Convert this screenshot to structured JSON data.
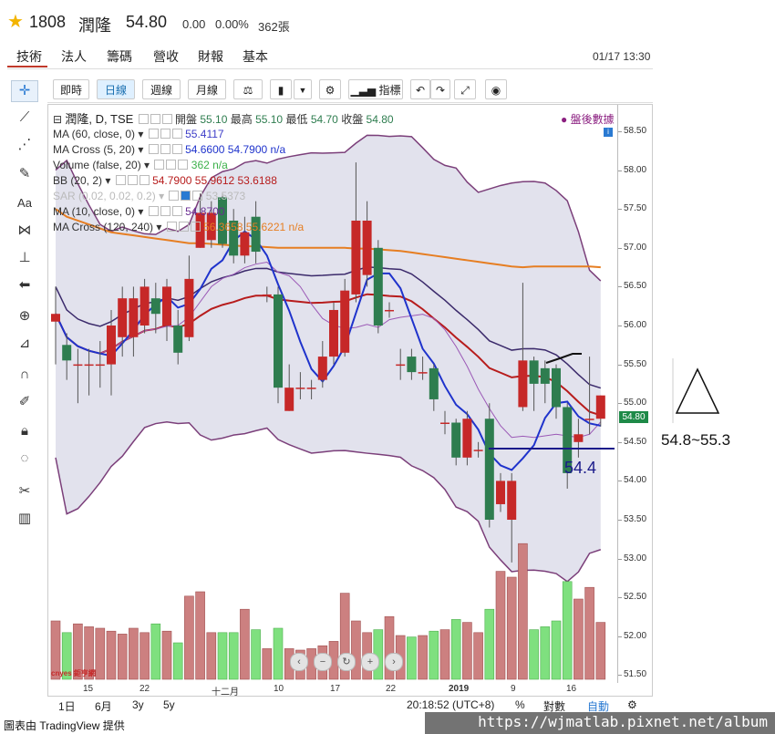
{
  "stock": {
    "code": "1808",
    "name": "潤隆",
    "price": "54.80",
    "change": "0.00",
    "change_pct": "0.00%",
    "volume": "362張"
  },
  "tabs": [
    "技術",
    "法人",
    "籌碼",
    "營收",
    "財報",
    "基本"
  ],
  "timestamp": "01/17 13:30",
  "toolbar": {
    "periods": [
      "即時",
      "日線",
      "週線",
      "月線"
    ],
    "indicators_label": "指標"
  },
  "legend": {
    "main": {
      "name": "潤隆, D, TSE",
      "open_label": "開盤",
      "open": "55.10",
      "high_label": "最高",
      "high": "55.10",
      "low_label": "最低",
      "low": "54.70",
      "close_label": "收盤",
      "close": "54.80"
    },
    "rows": [
      {
        "label": "MA (60, close, 0)",
        "values": "55.4117"
      },
      {
        "label": "MA Cross (5, 20)",
        "values": "54.6600 54.7900 n/a"
      },
      {
        "label": "Volume (false, 20)",
        "values": "362 n/a"
      },
      {
        "label": "BB (20, 2)",
        "values": "54.7900 55.9612 53.6188"
      },
      {
        "label": "SAR (0.02, 0.02, 0.2)",
        "values": "53.5373"
      },
      {
        "label": "MA (10, close, 0)",
        "values": "54.8700"
      },
      {
        "label": "MA Cross (120, 240)",
        "values": "56.3658 55.6221 n/a"
      }
    ],
    "after_hours": "盤後數據"
  },
  "y_ticks": [
    "58.50",
    "58.00",
    "57.50",
    "57.00",
    "56.50",
    "56.00",
    "55.50",
    "55.00",
    "54.50",
    "54.00",
    "53.50",
    "53.00",
    "52.50",
    "52.00",
    "51.50"
  ],
  "price_tag": "54.80",
  "x_ticks": [
    "15",
    "22",
    "十二月",
    "10",
    "17",
    "22",
    "2019",
    "9",
    "16"
  ],
  "bottom": {
    "ranges": [
      "1日",
      "6月",
      "3y",
      "5y"
    ],
    "clock": "20:18:52 (UTC+8)",
    "pct": "%",
    "log": "對數",
    "auto": "自動"
  },
  "annotations": {
    "target": "54.8~55.3",
    "support": "54.4"
  },
  "logo_text": "cnyes 鉅亨網",
  "footer": {
    "credit": "圖表由 TradingView 提供",
    "url": "https://wjmatlab.pixnet.net/album"
  },
  "colors": {
    "up": "#c62828",
    "down": "#2e7d4f",
    "ma60": "#e67e22",
    "ma_fast": "#1f33cc",
    "bb_mid": "#b71c1c",
    "bb_band": "#7b3f7a",
    "sar": "#9b59b6"
  },
  "chart_data": {
    "type": "candlestick",
    "ylim": [
      51.35,
      58.75
    ],
    "candles": [
      {
        "o": 56.05,
        "c": 56.15,
        "h": 56.5,
        "l": 55.5
      },
      {
        "o": 55.75,
        "c": 55.55,
        "h": 55.9,
        "l": 55.3
      },
      {
        "o": 55.5,
        "c": 55.5,
        "h": 55.7,
        "l": 55.0
      },
      {
        "o": 55.5,
        "c": 55.5,
        "h": 55.7,
        "l": 55.1
      },
      {
        "o": 55.5,
        "c": 55.5,
        "h": 55.8,
        "l": 55.2
      },
      {
        "o": 55.5,
        "c": 56.0,
        "h": 56.2,
        "l": 55.1
      },
      {
        "o": 55.85,
        "c": 56.35,
        "h": 56.5,
        "l": 55.6
      },
      {
        "o": 55.85,
        "c": 56.35,
        "h": 56.5,
        "l": 55.6
      },
      {
        "o": 56.0,
        "c": 56.5,
        "h": 56.6,
        "l": 55.9
      },
      {
        "o": 56.35,
        "c": 56.15,
        "h": 56.55,
        "l": 55.9
      },
      {
        "o": 56.0,
        "c": 56.5,
        "h": 56.6,
        "l": 55.8
      },
      {
        "o": 56.0,
        "c": 55.65,
        "h": 56.2,
        "l": 55.5
      },
      {
        "o": 55.85,
        "c": 56.6,
        "h": 56.9,
        "l": 55.8
      },
      {
        "o": 57.0,
        "c": 57.45,
        "h": 57.7,
        "l": 57.0
      },
      {
        "o": 57.1,
        "c": 57.45,
        "h": 57.6,
        "l": 57.0
      },
      {
        "o": 57.65,
        "c": 57.05,
        "h": 57.7,
        "l": 57.0
      },
      {
        "o": 57.35,
        "c": 56.9,
        "h": 57.5,
        "l": 56.8
      },
      {
        "o": 56.9,
        "c": 57.2,
        "h": 57.4,
        "l": 56.8
      },
      {
        "o": 57.4,
        "c": 56.95,
        "h": 57.6,
        "l": 56.8
      },
      {
        "o": 56.4,
        "c": 56.4,
        "h": 56.5,
        "l": 56.3
      },
      {
        "o": 56.4,
        "c": 55.2,
        "h": 56.5,
        "l": 55.0
      },
      {
        "o": 54.9,
        "c": 55.2,
        "h": 55.5,
        "l": 54.9
      },
      {
        "o": 55.2,
        "c": 55.2,
        "h": 55.4,
        "l": 55.05
      },
      {
        "o": 55.2,
        "c": 55.2,
        "h": 55.3,
        "l": 55.05
      },
      {
        "o": 55.3,
        "c": 55.6,
        "h": 55.8,
        "l": 55.2
      },
      {
        "o": 55.6,
        "c": 56.2,
        "h": 56.3,
        "l": 55.5
      },
      {
        "o": 55.65,
        "c": 56.45,
        "h": 56.6,
        "l": 55.6
      },
      {
        "o": 56.4,
        "c": 57.35,
        "h": 58.1,
        "l": 56.3
      },
      {
        "o": 56.65,
        "c": 57.35,
        "h": 57.6,
        "l": 56.5
      },
      {
        "o": 57.0,
        "c": 56.0,
        "h": 57.1,
        "l": 55.9
      },
      {
        "o": 56.2,
        "c": 56.2,
        "h": 56.3,
        "l": 56.1
      },
      {
        "o": 55.5,
        "c": 55.5,
        "h": 55.7,
        "l": 55.3
      },
      {
        "o": 55.6,
        "c": 55.4,
        "h": 55.7,
        "l": 55.3
      },
      {
        "o": 55.4,
        "c": 55.4,
        "h": 55.6,
        "l": 55.3
      },
      {
        "o": 55.45,
        "c": 55.05,
        "h": 55.5,
        "l": 54.9
      },
      {
        "o": 54.75,
        "c": 54.75,
        "h": 54.9,
        "l": 54.6
      },
      {
        "o": 54.75,
        "c": 54.3,
        "h": 54.8,
        "l": 54.2
      },
      {
        "o": 54.3,
        "c": 54.8,
        "h": 54.9,
        "l": 54.2
      },
      {
        "o": 54.4,
        "c": 54.4,
        "h": 54.5,
        "l": 54.3
      },
      {
        "o": 54.8,
        "c": 53.5,
        "h": 55.0,
        "l": 53.4
      },
      {
        "o": 53.7,
        "c": 54.0,
        "h": 54.1,
        "l": 53.6
      },
      {
        "o": 53.5,
        "c": 54.0,
        "h": 54.1,
        "l": 52.95
      },
      {
        "o": 54.95,
        "c": 55.55,
        "h": 56.55,
        "l": 54.9
      },
      {
        "o": 55.55,
        "c": 55.25,
        "h": 55.6,
        "l": 54.9
      },
      {
        "o": 55.45,
        "c": 55.25,
        "h": 55.55,
        "l": 55.0
      },
      {
        "o": 55.45,
        "c": 54.95,
        "h": 55.5,
        "l": 54.8
      },
      {
        "o": 54.95,
        "c": 54.1,
        "h": 55.0,
        "l": 53.9
      },
      {
        "o": 54.5,
        "c": 54.6,
        "h": 54.8,
        "l": 54.3
      },
      {
        "o": 54.8,
        "c": 54.8,
        "h": 55.6,
        "l": 54.6
      },
      {
        "o": 54.8,
        "c": 55.1,
        "h": 55.1,
        "l": 54.7
      }
    ],
    "volumes": [
      40,
      32,
      38,
      36,
      35,
      33,
      31,
      35,
      32,
      38,
      33,
      25,
      57,
      60,
      32,
      32,
      32,
      48,
      34,
      21,
      35,
      21,
      20,
      21,
      23,
      26,
      59,
      40,
      32,
      34,
      43,
      30,
      29,
      30,
      33,
      34,
      41,
      39,
      32,
      48,
      74,
      70,
      93,
      34,
      36,
      40,
      67,
      55,
      63,
      39
    ],
    "ma60": [
      57.5,
      57.4,
      57.35,
      57.3,
      57.25,
      57.2,
      57.18,
      57.16,
      57.14,
      57.12,
      57.1,
      57.08,
      57.06,
      57.06,
      57.05,
      57.04,
      57.03,
      57.02,
      57.02,
      57.01,
      57.0,
      57.0,
      57.0,
      57.0,
      57.0,
      57.0,
      57.0,
      56.99,
      56.99,
      56.98,
      56.97,
      56.96,
      56.94,
      56.92,
      56.9,
      56.88,
      56.86,
      56.84,
      56.82,
      56.8,
      56.78,
      56.76,
      56.75,
      56.76,
      56.76,
      56.76,
      56.76,
      56.76,
      56.76,
      56.75
    ]
  }
}
